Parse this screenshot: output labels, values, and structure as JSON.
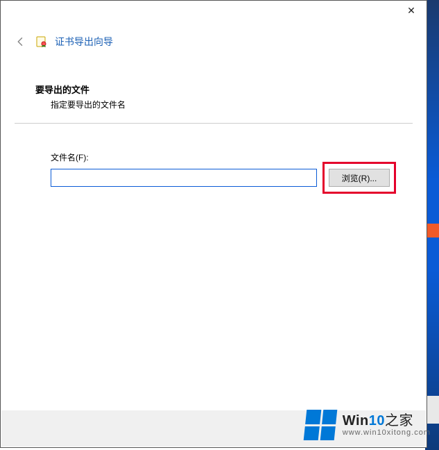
{
  "dialog": {
    "close_glyph": "✕",
    "back_glyph": "←",
    "title": "证书导出向导"
  },
  "section": {
    "heading": "要导出的文件",
    "sub": "指定要导出的文件名"
  },
  "field": {
    "label": "文件名(F):",
    "value": "",
    "browse_label": "浏览(R)..."
  },
  "watermark": {
    "brand_prefix": "Win",
    "brand_num": "10",
    "brand_suffix": "之家",
    "url": "www.win10xitong.com"
  }
}
